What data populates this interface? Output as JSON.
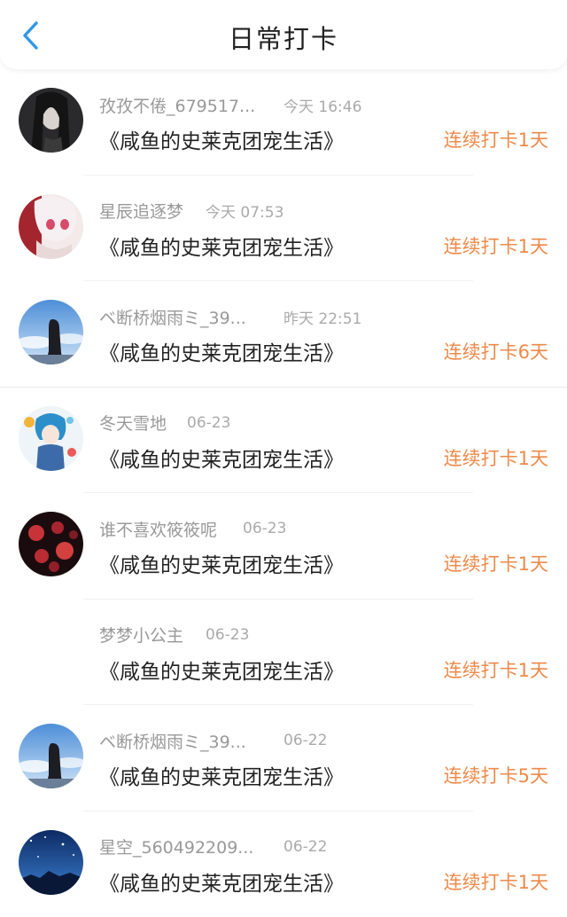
{
  "header": {
    "title": "日常打卡",
    "back_icon": "chevron-left-icon"
  },
  "colors": {
    "accent": "#2f97e8",
    "streak": "#ee8a4a",
    "meta": "#999999"
  },
  "checkins": [
    {
      "name": "孜孜不倦_679517...",
      "time": "今天 16:46",
      "book": "《咸鱼的史莱克团宠生活》",
      "streak": "连续打卡1天",
      "avatar": "avatar-girl-dark"
    },
    {
      "name": "星辰追逐梦",
      "time": "今天 07:53",
      "book": "《咸鱼的史莱克团宠生活》",
      "streak": "连续打卡1天",
      "avatar": "avatar-anime-pink"
    },
    {
      "name": "ベ断桥烟雨ミ_39...",
      "time": "昨天 22:51",
      "book": "《咸鱼的史莱克团宠生活》",
      "streak": "连续打卡6天",
      "avatar": "avatar-sky-silhouette"
    },
    {
      "name": "冬天雪地",
      "time": "06-23",
      "book": "《咸鱼的史莱克团宠生活》",
      "streak": "连续打卡1天",
      "avatar": "avatar-anime-blue"
    },
    {
      "name": "谁不喜欢筱筱呢",
      "time": "06-23",
      "book": "《咸鱼的史莱克团宠生活》",
      "streak": "连续打卡1天",
      "avatar": "avatar-red-roses"
    },
    {
      "name": "梦梦小公主",
      "time": "06-23",
      "book": "《咸鱼的史莱克团宠生活》",
      "streak": "连续打卡1天",
      "avatar": "avatar-blank"
    },
    {
      "name": "ベ断桥烟雨ミ_39...",
      "time": "06-22",
      "book": "《咸鱼的史莱克团宠生活》",
      "streak": "连续打卡5天",
      "avatar": "avatar-sky-silhouette"
    },
    {
      "name": "星空_560492209...",
      "time": "06-22",
      "book": "《咸鱼的史莱克团宠生活》",
      "streak": "连续打卡1天",
      "avatar": "avatar-night-sky"
    }
  ]
}
